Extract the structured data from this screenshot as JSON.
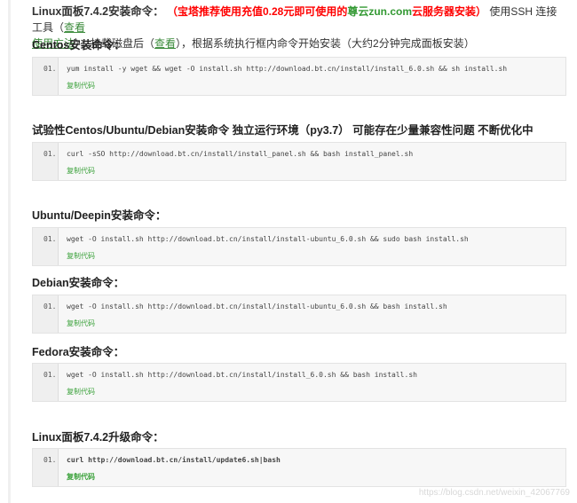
{
  "intro": {
    "label": "Linux面板7.4.2安装命令：",
    "red_prefix": "（宝塔推荐使用充值0.28元即可使用的",
    "red_green": "尊云zun.com",
    "red_suffix": "云服务器安装）",
    "text1": "使用SSH 连接工具（",
    "link1a": "查看",
    "link1b": "使用方法",
    "text2": "），挂载磁盘后（",
    "link2": "查看",
    "text3": "），根据系统执行框内命令开始安装（大约2分钟完成面板安装）"
  },
  "sections": [
    {
      "heading": "Centos安装命令：",
      "num": "01.",
      "command": "yum install -y wget && wget -O install.sh http://download.bt.cn/install/install_6.0.sh && sh install.sh",
      "copy": "复制代码"
    },
    {
      "heading": "试验性Centos/Ubuntu/Debian安装命令 独立运行环境（py3.7） 可能存在少量兼容性问题 不断优化中",
      "num": "01.",
      "command": "curl -sSO http://download.bt.cn/install/install_panel.sh && bash install_panel.sh",
      "copy": "复制代码"
    },
    {
      "heading": "Ubuntu/Deepin安装命令：",
      "num": "01.",
      "command": "wget -O install.sh http://download.bt.cn/install/install-ubuntu_6.0.sh && sudo bash install.sh",
      "copy": "复制代码"
    },
    {
      "heading": "Debian安装命令：",
      "num": "01.",
      "command": "wget -O install.sh http://download.bt.cn/install/install-ubuntu_6.0.sh && bash install.sh",
      "copy": "复制代码"
    },
    {
      "heading": "Fedora安装命令：",
      "num": "01.",
      "command": "wget -O install.sh http://download.bt.cn/install/install_6.0.sh && bash install.sh",
      "copy": "复制代码"
    },
    {
      "heading": "Linux面板7.4.2升级命令：",
      "num": "01.",
      "command": "curl http://download.bt.cn/install/update6.sh|bash",
      "copy": "复制代码"
    }
  ],
  "watermark": "https://blog.csdn.net/weixin_42067769"
}
